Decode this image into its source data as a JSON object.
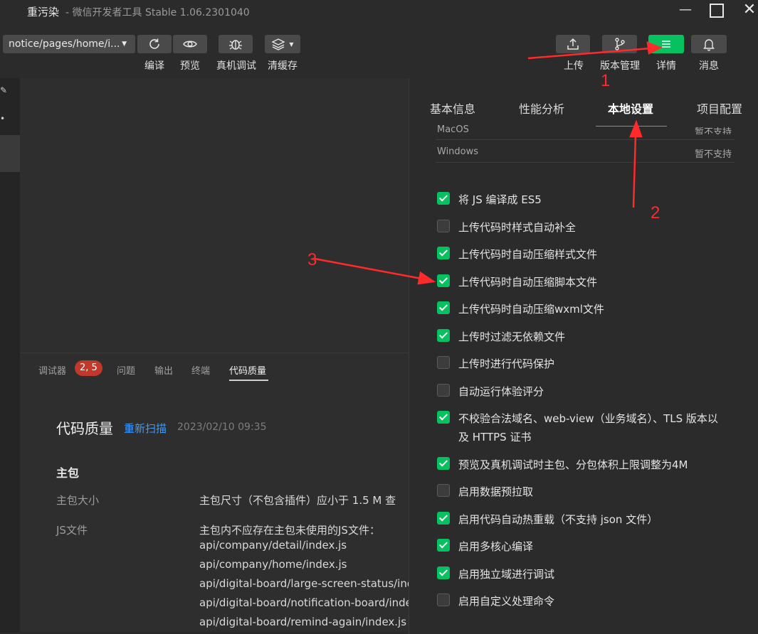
{
  "titlebar": {
    "project": "重污染",
    "app": "- 微信开发者工具 Stable 1.06.2301040",
    "icons": [
      "minimize-icon",
      "maximize-icon",
      "close-icon"
    ]
  },
  "toolbar": {
    "path": "notice/pages/home/i...",
    "compile_label": "编译",
    "preview_label": "预览",
    "remote_debug_label": "真机调试",
    "clear_cache_label": "清缓存",
    "upload_label": "上传",
    "version_label": "版本管理",
    "details_label": "详情",
    "messages_label": "消息",
    "accent": "#07c160"
  },
  "bottom": {
    "tabs": [
      "调试器",
      "问题",
      "输出",
      "终端",
      "代码质量"
    ],
    "badge": "2, 5",
    "active_tab": "代码质量",
    "title": "代码质量",
    "rescan": "重新扫描",
    "date": "2023/02/10 09:35",
    "section": "主包",
    "rows": [
      {
        "label": "主包大小",
        "text": "主包尺寸（不包含插件）应小于 1.5 M 查"
      },
      {
        "label": "JS文件",
        "text": "主包内不应存在主包未使用的JS文件："
      }
    ],
    "files": [
      "api/company/detail/index.js",
      "api/company/home/index.js",
      "api/digital-board/large-screen-status/ind",
      "api/digital-board/notification-board/inde",
      "api/digital-board/remind-again/index.js"
    ]
  },
  "panel": {
    "tabs": [
      "基本信息",
      "性能分析",
      "本地设置",
      "项目配置"
    ],
    "active_tab": "本地设置",
    "os_rows": [
      {
        "os": "MacOS",
        "status": "暂不支持"
      },
      {
        "os": "Windows",
        "status": "暂不支持"
      }
    ],
    "settings": [
      {
        "label": "将 JS 编译成 ES5",
        "checked": true
      },
      {
        "label": "上传代码时样式自动补全",
        "checked": false
      },
      {
        "label": "上传代码时自动压缩样式文件",
        "checked": true
      },
      {
        "label": "上传代码时自动压缩脚本文件",
        "checked": true
      },
      {
        "label": "上传代码时自动压缩wxml文件",
        "checked": true
      },
      {
        "label": "上传时过滤无依赖文件",
        "checked": true
      },
      {
        "label": "上传时进行代码保护",
        "checked": false
      },
      {
        "label": "自动运行体验评分",
        "checked": false
      },
      {
        "label": "不校验合法域名、web-view（业务域名）、TLS 版本以及 HTTPS 证书",
        "checked": true
      },
      {
        "label": "预览及真机调试时主包、分包体积上限调整为4M",
        "checked": true
      },
      {
        "label": "启用数据预拉取",
        "checked": false
      },
      {
        "label": "启用代码自动热重载（不支持 json 文件）",
        "checked": true
      },
      {
        "label": "启用多核心编译",
        "checked": true
      },
      {
        "label": "启用独立域进行调试",
        "checked": true
      },
      {
        "label": "启用自定义处理命令",
        "checked": false
      }
    ]
  },
  "annotations": {
    "one": "1",
    "two": "2",
    "three": "3",
    "color": "#ff2a2a"
  }
}
